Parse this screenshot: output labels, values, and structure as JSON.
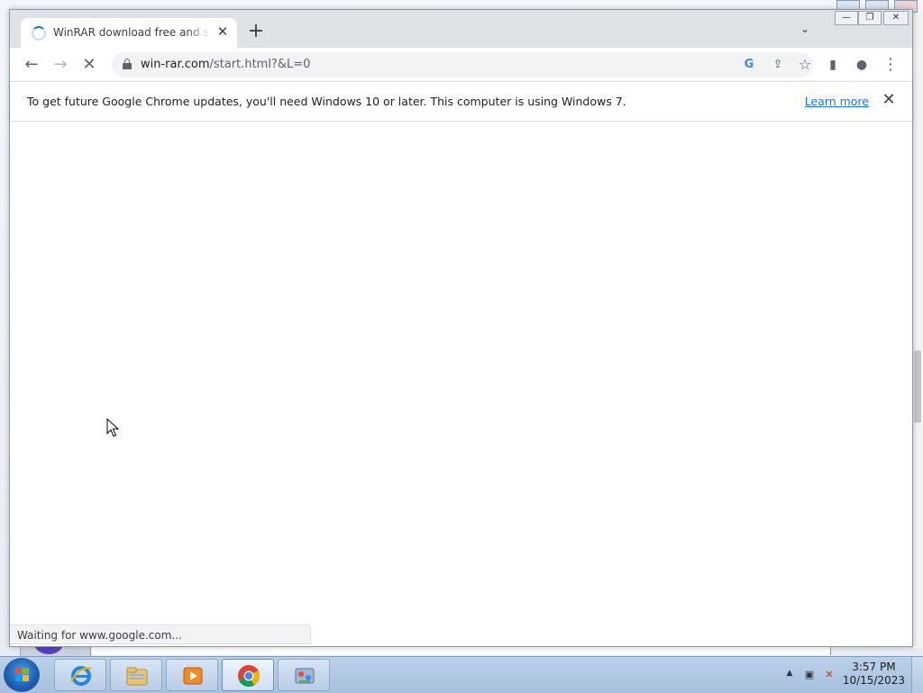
{
  "browser": {
    "tab": {
      "title": "WinRAR download free and support",
      "close_label": "✕"
    },
    "new_tab_label": "+",
    "tab_search_label": "⌄",
    "window_controls": {
      "minimize": "—",
      "restore": "❐",
      "close": "✕"
    },
    "toolbar": {
      "back_label": "←",
      "forward_label": "→",
      "stop_label": "✕",
      "url_host": "win-rar.com",
      "url_path": "/start.html?&L=0",
      "google_icon_label": "G",
      "share_label": "⇪",
      "bookmark_label": "☆",
      "sidepanel_label": "▮",
      "profile_label": "●",
      "menu_label": "⋮"
    },
    "infobar": {
      "message": "To get future Google Chrome updates, you'll need Windows 10 or later. This computer is using Windows 7.",
      "link": "Learn more",
      "close_label": "✕"
    },
    "status": "Waiting for www.google.com..."
  },
  "taskbar": {
    "items": [
      "internet-explorer",
      "windows-explorer",
      "media-player",
      "google-chrome",
      "control-panel"
    ],
    "clock": {
      "time": "3:57 PM",
      "date": "10/15/2023"
    },
    "tray": {
      "show_hidden": "▲",
      "network": "▣",
      "volume": "✕"
    }
  }
}
